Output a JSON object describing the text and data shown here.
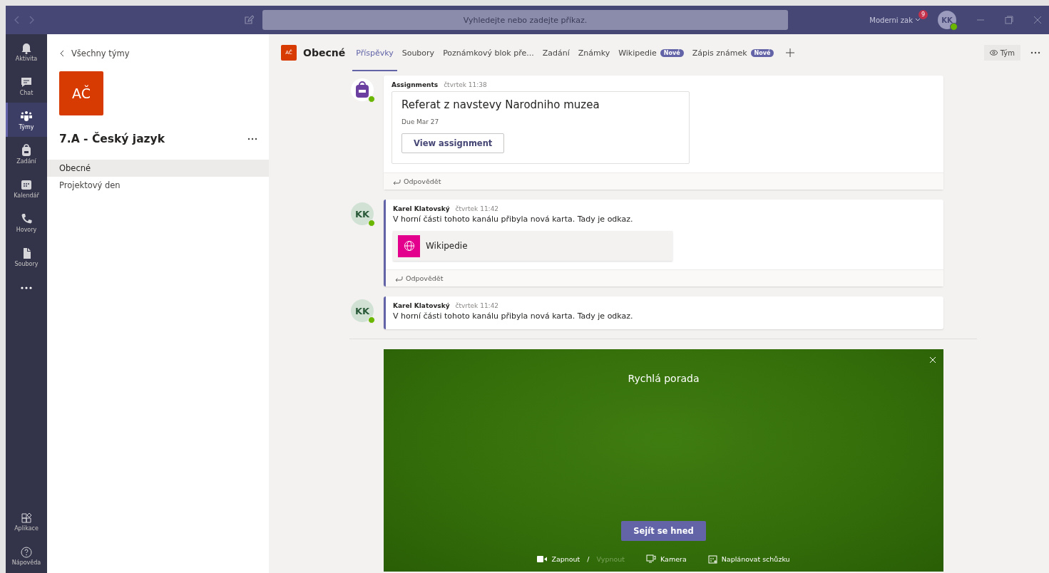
{
  "title_bar": {
    "search_placeholder": "Vyhledejte nebo zadejte příkaz.",
    "user_name": "Moderni zak",
    "notification_count": "9",
    "avatar_initials": "KK"
  },
  "app_rail": {
    "items": [
      {
        "label": "Aktivita",
        "selected": false
      },
      {
        "label": "Chat",
        "selected": false
      },
      {
        "label": "Týmy",
        "selected": true
      },
      {
        "label": "Zadání",
        "selected": false
      },
      {
        "label": "Kalendář",
        "selected": false
      },
      {
        "label": "Hovory",
        "selected": false
      },
      {
        "label": "Soubory",
        "selected": false
      }
    ],
    "bottom_items": [
      {
        "label": "Aplikace"
      },
      {
        "label": "Nápověda"
      }
    ]
  },
  "team_panel": {
    "back_label": "Všechny týmy",
    "team_initials": "AČ",
    "team_name": "7.A - Český jazyk",
    "channels": [
      {
        "name": "Obecné",
        "selected": true
      },
      {
        "name": "Projektový den",
        "selected": false
      }
    ]
  },
  "channel_header": {
    "team_initials": "AČ",
    "channel_name": "Obecné",
    "tabs": [
      {
        "label": "Příspěvky",
        "selected": true
      },
      {
        "label": "Soubory",
        "selected": false
      },
      {
        "label": "Poznámkový blok pře...",
        "selected": false
      },
      {
        "label": "Zadání",
        "selected": false
      },
      {
        "label": "Známky",
        "selected": false
      },
      {
        "label": "Wikipedie",
        "selected": false,
        "badge": "Nové"
      },
      {
        "label": "Zápis známek",
        "selected": false,
        "badge": "Nové"
      }
    ],
    "team_button": "Tým"
  },
  "posts": [
    {
      "kind": "assignment",
      "author": "Assignments",
      "time": "čtvrtek 11:38",
      "card_title": "Referat z navstevy Narodniho muzea",
      "due": "Due Mar 27",
      "button": "View assignment",
      "reply": "Odpovědět"
    },
    {
      "kind": "message",
      "author": "Karel Klatovský",
      "avatar_initials": "KK",
      "time": "čtvrtek 11:42",
      "text": "V horní části tohoto kanálu přibyla nová karta. Tady je odkaz.",
      "link_card": "Wikipedie",
      "reply": "Odpovědět"
    },
    {
      "kind": "message",
      "author": "Karel Klatovský",
      "avatar_initials": "KK",
      "time": "čtvrtek 11:42",
      "text": "V horní části tohoto kanálu přibyla nová karta. Tady je odkaz."
    }
  ],
  "meeting_panel": {
    "title": "Rychlá porada",
    "button": "Sejít se hned",
    "video_options": [
      {
        "label": "Zapnout",
        "selected": true
      },
      {
        "label": "Vypnout",
        "selected": false
      }
    ],
    "separator": "/",
    "camera": "Kamera",
    "schedule": "Naplánovat schůzku"
  }
}
